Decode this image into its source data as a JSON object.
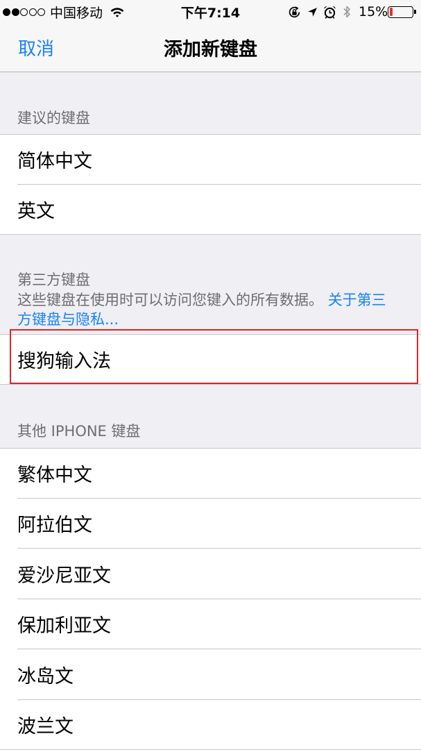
{
  "status_bar": {
    "signal": {
      "filled": 2,
      "total": 5
    },
    "carrier": "中国移动",
    "time": "下午7:14",
    "battery_text": "15%",
    "battery_level": 15,
    "icons": [
      "wifi-icon",
      "rotation-lock-icon",
      "location-icon",
      "alarm-icon",
      "bluetooth-icon",
      "battery-icon"
    ]
  },
  "nav": {
    "cancel_label": "取消",
    "title": "添加新键盘"
  },
  "suggested": {
    "header": "建议的键盘",
    "items": [
      "简体中文",
      "英文"
    ]
  },
  "third_party": {
    "header": "第三方键盘",
    "description": "这些键盘在使用时可以访问您键入的所有数据。",
    "privacy_link": "关于第三方键盘与隐私...",
    "items": [
      "搜狗输入法"
    ]
  },
  "other": {
    "header": "其他 IPHONE 键盘",
    "items": [
      "繁体中文",
      "阿拉伯文",
      "爱沙尼亚文",
      "保加利亚文",
      "冰岛文",
      "波兰文"
    ]
  },
  "colors": {
    "accent": "#1a82f6",
    "highlight": "#e42323",
    "battery_low": "#e5302b",
    "background": "#efeff4",
    "secondary_text": "#6d6d72"
  }
}
